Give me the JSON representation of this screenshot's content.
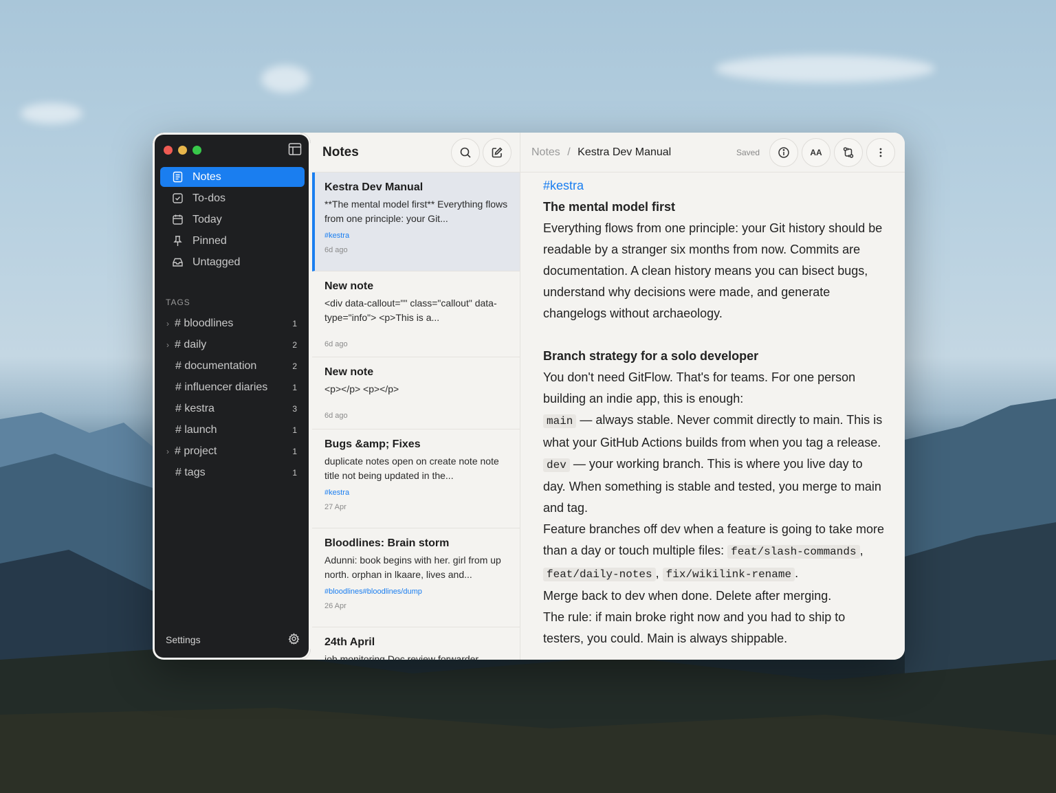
{
  "sidebar": {
    "nav": [
      {
        "label": "Notes",
        "icon": "notes-icon",
        "active": true
      },
      {
        "label": "To-dos",
        "icon": "checkbox-icon"
      },
      {
        "label": "Today",
        "icon": "calendar-icon"
      },
      {
        "label": "Pinned",
        "icon": "pin-icon"
      },
      {
        "label": "Untagged",
        "icon": "inbox-icon"
      }
    ],
    "tags_heading": "TAGS",
    "tags": [
      {
        "name": "# bloodlines",
        "count": "1",
        "expandable": true
      },
      {
        "name": "# daily",
        "count": "2",
        "expandable": true
      },
      {
        "name": "# documentation",
        "count": "2"
      },
      {
        "name": "# influencer diaries",
        "count": "1"
      },
      {
        "name": "# kestra",
        "count": "3"
      },
      {
        "name": "# launch",
        "count": "1"
      },
      {
        "name": "# project",
        "count": "1",
        "expandable": true
      },
      {
        "name": "# tags",
        "count": "1"
      }
    ],
    "settings_label": "Settings"
  },
  "list": {
    "title": "Notes",
    "notes": [
      {
        "title": "Kestra Dev Manual",
        "preview": "**The mental model first** Everything flows from one principle: your Git...",
        "tag": "#kestra",
        "date": "6d ago"
      },
      {
        "title": "New note",
        "preview": "<div data-callout=\"\" class=\"callout\" data-type=\"info\"> <p>This is a...",
        "tag": "",
        "date": "6d ago"
      },
      {
        "title": "New note",
        "preview": "<p></p> <p></p>",
        "tag": "",
        "date": "6d ago"
      },
      {
        "title": "Bugs &amp; Fixes",
        "preview": "duplicate notes open on create note note title not being updated in the...",
        "tag": "#kestra",
        "date": "27 Apr"
      },
      {
        "title": "Bloodlines: Brain storm",
        "preview": "Adunni: book begins with her. girl from up north. orphan in lkaare, lives and...",
        "tag": "#bloodlines#bloodlines/dump",
        "date": "26 Apr"
      },
      {
        "title": "24th April",
        "preview": "job monitoring Doc review forwarder",
        "tag": "",
        "date": ""
      }
    ]
  },
  "editor": {
    "breadcrumb_root": "Notes",
    "breadcrumb_sep": "/",
    "breadcrumb_current": "Kestra Dev Manual",
    "status": "Saved",
    "hashtag": "#kestra",
    "h1": "The mental model first",
    "p1": "Everything flows from one principle: your Git history should be readable by a stranger six months from now. Commits are documentation. A clean history means you can bisect bugs, understand why decisions were made, and generate changelogs without archaeology.",
    "h2": "Branch strategy for a solo developer",
    "p2": "You don't need GitFlow. That's for teams. For one person building an indie app, this is enough:",
    "main_code": "main",
    "main_text": " — always stable. Never commit directly to main. This is what your GitHub Actions builds from when you tag a release.",
    "dev_code": "dev",
    "dev_text": " — your working branch. This is where you live day to day. When something is stable and tested, you merge to main and tag.",
    "feat_text": "Feature branches off dev when a feature is going to take more than a day or touch multiple files: ",
    "code1": "feat/slash-commands",
    "sep1": ", ",
    "code2": "feat/daily-notes",
    "sep2": ", ",
    "code3": "fix/wikilink-rename",
    "end": ".",
    "merge_text": "Merge back to dev when done. Delete after merging.",
    "rule_text": "The rule: if main broke right now and you had to ship to testers, you could. Main is always shippable."
  },
  "colors": {
    "accent": "#1a7ef0",
    "sidebar_bg": "#1e1f21",
    "content_bg": "#f4f3f0"
  }
}
